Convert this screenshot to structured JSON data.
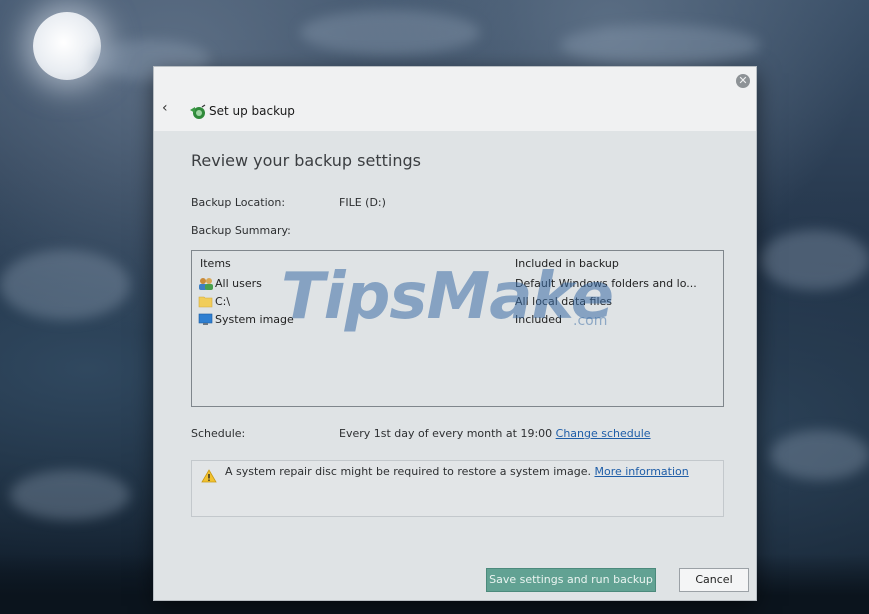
{
  "window": {
    "title": "Set up backup",
    "close_glyph": "✕",
    "back_glyph": "‹"
  },
  "page": {
    "heading": "Review your backup settings",
    "backup_location_label": "Backup Location:",
    "backup_location_value": "FILE (D:)",
    "backup_summary_label": "Backup Summary:"
  },
  "summary_table": {
    "headers": [
      "Items",
      "Included in backup"
    ],
    "rows": [
      {
        "item": "All users",
        "included": "Default Windows folders and lo...",
        "icon": "users-icon"
      },
      {
        "item": "C:\\",
        "included": "All local data files",
        "icon": "folder-icon"
      },
      {
        "item": "System image",
        "included": "Included",
        "icon": "monitor-icon"
      }
    ]
  },
  "schedule": {
    "label": "Schedule:",
    "value": "Every 1st day of every month at 19:00",
    "link": "Change schedule"
  },
  "warning": {
    "text": "A system repair disc might be required to restore a system image.",
    "link": "More information",
    "icon": "warning-icon"
  },
  "buttons": {
    "primary": "Save settings and run backup",
    "cancel": "Cancel"
  },
  "watermark": {
    "main": "TipsMake",
    "suffix": ".com"
  },
  "colors": {
    "primary_button": "#62a293",
    "link": "#1f5ea8",
    "dialog_bg": "#dfe3e5",
    "header_bg": "#f0f1f2"
  }
}
